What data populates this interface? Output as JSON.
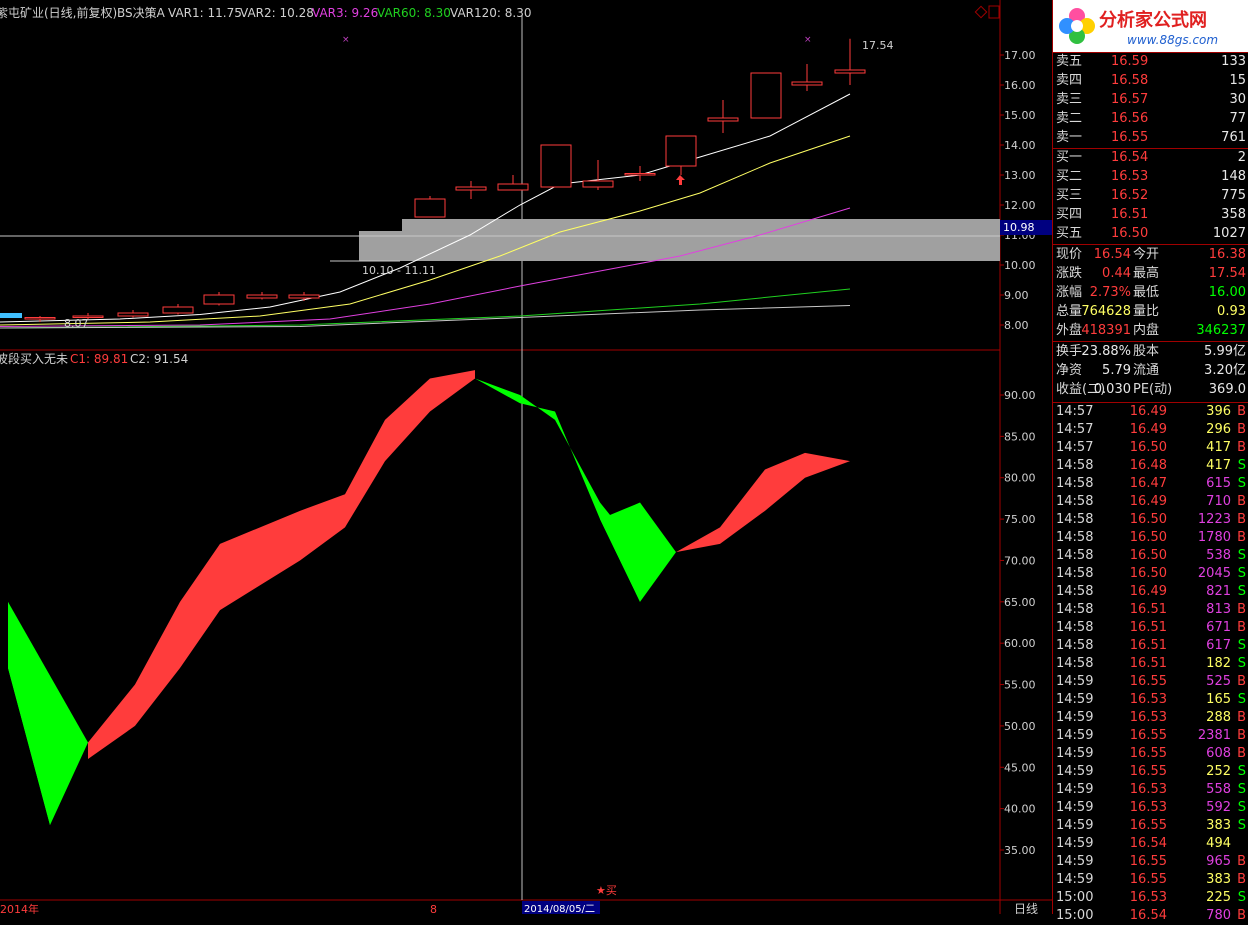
{
  "chart_header": {
    "title": "紫屯矿业(日线,前复权)",
    "indicator": "BS决策A",
    "var1": "VAR1: 11.75",
    "var2": "VAR2: 10.28",
    "var3": "VAR3: 9.26",
    "var60": "VAR60: 8.30",
    "var120": "VAR120: 8.30"
  },
  "lower_header": {
    "name": "波段买入无未",
    "c1": "C1: 89.81",
    "c2": "C2: 91.54"
  },
  "price_labels": {
    "high": "17.54",
    "low": "8.07",
    "box": "10.10 - 11.11",
    "current": "10.98"
  },
  "bottom_axis": {
    "left": "2014年",
    "mid": "8",
    "cursor": "2014/08/05/二",
    "period": "日线",
    "buy_marker": "★买"
  },
  "colors": {
    "bg": "#000000",
    "up": "#ff3c3c",
    "down": "#00ff00",
    "grid": "#7a0000",
    "ma1": "#ffffff",
    "ma2": "#ffff64",
    "ma3": "#e040e0",
    "ma4": "#20d020",
    "ma5": "#c8c8c8"
  },
  "chart_data": [
    {
      "type": "candlestick",
      "name": "price",
      "y_ticks": [
        "17.00",
        "16.00",
        "15.00",
        "14.00",
        "13.00",
        "12.00",
        "11.00",
        "10.00",
        "9.00",
        "8.00"
      ],
      "ylim": [
        7.6,
        17.9
      ],
      "candles": [
        {
          "o": 8.2,
          "c": 8.25,
          "h": 8.3,
          "l": 8.1
        },
        {
          "o": 8.25,
          "c": 8.3,
          "h": 8.4,
          "l": 8.2
        },
        {
          "o": 8.3,
          "c": 8.4,
          "h": 8.5,
          "l": 8.25
        },
        {
          "o": 8.4,
          "c": 8.6,
          "h": 8.7,
          "l": 8.35
        },
        {
          "o": 8.7,
          "c": 9.0,
          "h": 9.1,
          "l": 8.65
        },
        {
          "o": 8.9,
          "c": 9.0,
          "h": 9.1,
          "l": 8.85
        },
        {
          "o": 8.9,
          "c": 9.0,
          "h": 9.1,
          "l": 8.8
        },
        {
          "o": 11.6,
          "c": 12.2,
          "h": 12.3,
          "l": 11.6
        },
        {
          "o": 12.5,
          "c": 12.6,
          "h": 12.8,
          "l": 12.2
        },
        {
          "o": 12.5,
          "c": 12.7,
          "h": 13.0,
          "l": 12.5
        },
        {
          "o": 12.6,
          "c": 14.0,
          "h": 14.0,
          "l": 12.6
        },
        {
          "o": 12.6,
          "c": 12.8,
          "h": 13.5,
          "l": 12.5
        },
        {
          "o": 13.0,
          "c": 13.05,
          "h": 13.3,
          "l": 12.8
        },
        {
          "o": 13.3,
          "c": 14.3,
          "h": 14.3,
          "l": 13.0
        },
        {
          "o": 14.8,
          "c": 14.9,
          "h": 15.5,
          "l": 14.4
        },
        {
          "o": 14.9,
          "c": 16.4,
          "h": 16.4,
          "l": 14.9
        },
        {
          "o": 16.0,
          "c": 16.1,
          "h": 16.7,
          "l": 15.8
        },
        {
          "o": 16.4,
          "c": 16.5,
          "h": 17.54,
          "l": 16.0
        }
      ]
    },
    {
      "type": "area",
      "name": "band",
      "y_ticks": [
        "90.00",
        "85.00",
        "80.00",
        "75.00",
        "70.00",
        "65.00",
        "60.00",
        "55.00",
        "50.00",
        "45.00",
        "40.00",
        "35.00"
      ],
      "ylim": [
        31,
        96
      ],
      "up_upper": [
        48,
        55,
        65,
        72,
        76,
        78,
        87,
        92,
        93
      ],
      "up_lower": [
        46,
        50,
        57,
        64,
        70,
        74,
        82,
        88,
        92
      ],
      "down1_upper": [
        65,
        48
      ],
      "down1_lower": [
        57,
        38
      ],
      "down2_upper": [
        92,
        90,
        87,
        77,
        71
      ],
      "down2_lower": [
        92,
        89,
        88,
        75,
        65
      ],
      "up2_upper": [
        71,
        74,
        78,
        81,
        83,
        82
      ],
      "up2_lower": [
        71,
        72,
        75,
        79,
        81,
        82
      ]
    }
  ],
  "quote_panel": {
    "logo_text": "分析家公式网",
    "logo_url": "www.88gs.com",
    "asks": [
      [
        "卖五",
        "16.59",
        "133"
      ],
      [
        "卖四",
        "16.58",
        "15"
      ],
      [
        "卖三",
        "16.57",
        "30"
      ],
      [
        "卖二",
        "16.56",
        "77"
      ],
      [
        "卖一",
        "16.55",
        "761"
      ]
    ],
    "bids": [
      [
        "买一",
        "16.54",
        "2"
      ],
      [
        "买二",
        "16.53",
        "148"
      ],
      [
        "买三",
        "16.52",
        "775"
      ],
      [
        "买四",
        "16.51",
        "358"
      ],
      [
        "买五",
        "16.50",
        "1027"
      ]
    ],
    "stats": [
      [
        "现价",
        "16.54",
        "今开",
        "16.38"
      ],
      [
        "涨跌",
        "0.44",
        "最高",
        "17.54"
      ],
      [
        "涨幅",
        "2.73%",
        "最低",
        "16.00"
      ],
      [
        "总量",
        "764628",
        "量比",
        "0.93"
      ],
      [
        "外盘",
        "418391",
        "内盘",
        "346237"
      ]
    ],
    "fund": [
      [
        "换手",
        "23.88%",
        "股本",
        "5.99亿"
      ],
      [
        "净资",
        "5.79",
        "流通",
        "3.20亿"
      ],
      [
        "收益(二)",
        "0.030",
        "PE(动)",
        "369.0"
      ]
    ],
    "ticks": [
      [
        "14:57",
        "16.49",
        "396",
        "B"
      ],
      [
        "14:57",
        "16.49",
        "296",
        "B"
      ],
      [
        "14:57",
        "16.50",
        "417",
        "B"
      ],
      [
        "14:58",
        "16.48",
        "417",
        "S"
      ],
      [
        "14:58",
        "16.47",
        "615",
        "S"
      ],
      [
        "14:58",
        "16.49",
        "710",
        "B"
      ],
      [
        "14:58",
        "16.50",
        "1223",
        "B"
      ],
      [
        "14:58",
        "16.50",
        "1780",
        "B"
      ],
      [
        "14:58",
        "16.50",
        "538",
        "S"
      ],
      [
        "14:58",
        "16.50",
        "2045",
        "S"
      ],
      [
        "14:58",
        "16.49",
        "821",
        "S"
      ],
      [
        "14:58",
        "16.51",
        "813",
        "B"
      ],
      [
        "14:58",
        "16.51",
        "671",
        "B"
      ],
      [
        "14:58",
        "16.51",
        "617",
        "S"
      ],
      [
        "14:58",
        "16.51",
        "182",
        "S"
      ],
      [
        "14:59",
        "16.55",
        "525",
        "B"
      ],
      [
        "14:59",
        "16.53",
        "165",
        "S"
      ],
      [
        "14:59",
        "16.53",
        "288",
        "B"
      ],
      [
        "14:59",
        "16.55",
        "2381",
        "B"
      ],
      [
        "14:59",
        "16.55",
        "608",
        "B"
      ],
      [
        "14:59",
        "16.55",
        "252",
        "S"
      ],
      [
        "14:59",
        "16.53",
        "558",
        "S"
      ],
      [
        "14:59",
        "16.53",
        "592",
        "S"
      ],
      [
        "14:59",
        "16.55",
        "383",
        "S"
      ],
      [
        "14:59",
        "16.54",
        "494",
        ""
      ],
      [
        "14:59",
        "16.55",
        "965",
        "B"
      ],
      [
        "14:59",
        "16.55",
        "383",
        "B"
      ],
      [
        "15:00",
        "16.53",
        "225",
        "S"
      ],
      [
        "15:00",
        "16.54",
        "780",
        "B"
      ]
    ]
  }
}
